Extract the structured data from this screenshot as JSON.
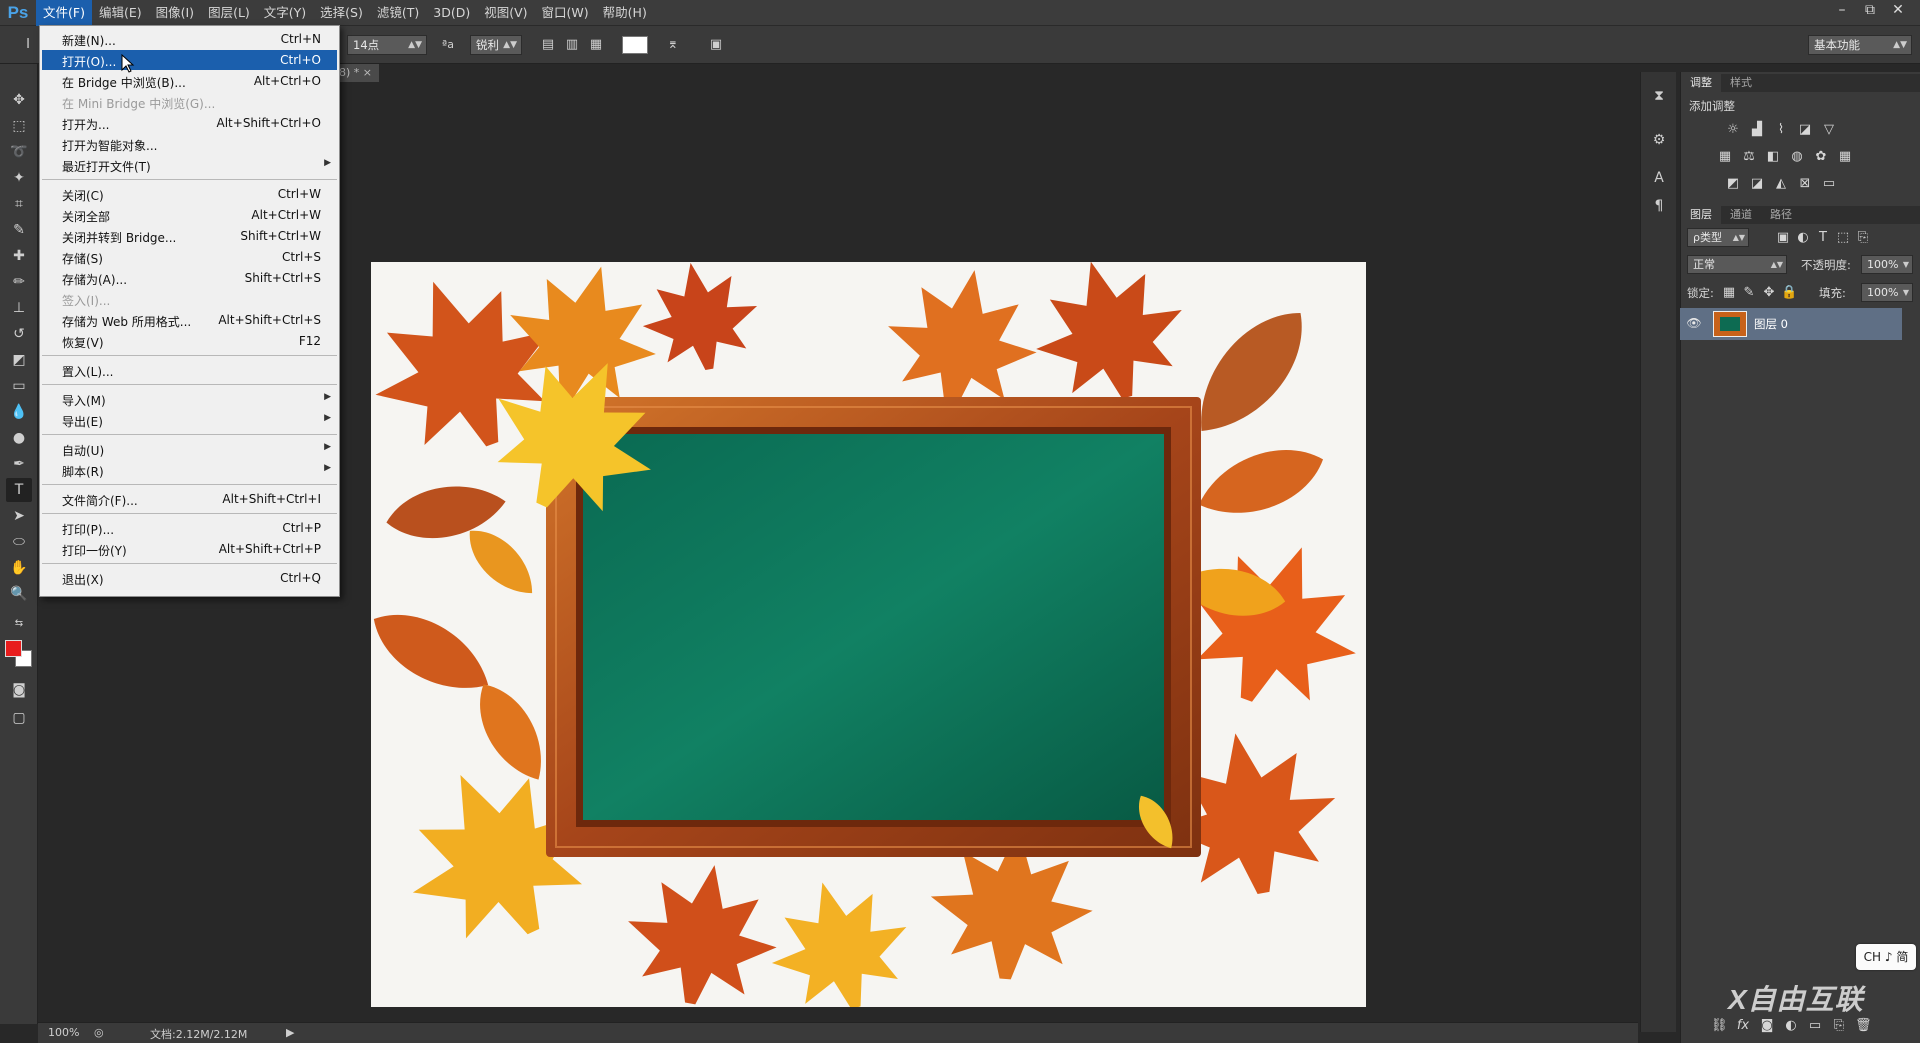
{
  "app": {
    "logo": "Ps",
    "menus": [
      "文件(F)",
      "编辑(E)",
      "图像(I)",
      "图层(L)",
      "文字(Y)",
      "选择(S)",
      "滤镜(T)",
      "3D(D)",
      "视图(V)",
      "窗口(W)",
      "帮助(H)"
    ],
    "active_menu": "文件(F)",
    "window_controls": [
      "–",
      "⧉",
      "✕"
    ]
  },
  "options_bar": {
    "font_size": "14点",
    "aa_icon": "ªa",
    "antialias": "锐利",
    "workspace": "基本功能"
  },
  "document": {
    "tab_label": "8) * ×",
    "zoom": "100%",
    "doc_info": "文档:2.12M/2.12M"
  },
  "file_menu": {
    "items": [
      {
        "label": "新建(N)...",
        "shortcut": "Ctrl+N"
      },
      {
        "label": "打开(O)...",
        "shortcut": "Ctrl+O",
        "highlighted": true
      },
      {
        "label": "在 Bridge 中浏览(B)...",
        "shortcut": "Alt+Ctrl+O"
      },
      {
        "label": "在 Mini Bridge 中浏览(G)...",
        "shortcut": "",
        "disabled": true
      },
      {
        "label": "打开为...",
        "shortcut": "Alt+Shift+Ctrl+O"
      },
      {
        "label": "打开为智能对象...",
        "shortcut": ""
      },
      {
        "label": "最近打开文件(T)",
        "shortcut": "",
        "submenu": true
      },
      {
        "separator": true
      },
      {
        "label": "关闭(C)",
        "shortcut": "Ctrl+W"
      },
      {
        "label": "关闭全部",
        "shortcut": "Alt+Ctrl+W"
      },
      {
        "label": "关闭并转到 Bridge...",
        "shortcut": "Shift+Ctrl+W"
      },
      {
        "label": "存储(S)",
        "shortcut": "Ctrl+S"
      },
      {
        "label": "存储为(A)...",
        "shortcut": "Shift+Ctrl+S"
      },
      {
        "label": "签入(I)...",
        "shortcut": "",
        "disabled": true
      },
      {
        "label": "存储为 Web 所用格式...",
        "shortcut": "Alt+Shift+Ctrl+S"
      },
      {
        "label": "恢复(V)",
        "shortcut": "F12"
      },
      {
        "separator": true
      },
      {
        "label": "置入(L)...",
        "shortcut": ""
      },
      {
        "separator": true
      },
      {
        "label": "导入(M)",
        "shortcut": "",
        "submenu": true
      },
      {
        "label": "导出(E)",
        "shortcut": "",
        "submenu": true
      },
      {
        "separator": true
      },
      {
        "label": "自动(U)",
        "shortcut": "",
        "submenu": true
      },
      {
        "label": "脚本(R)",
        "shortcut": "",
        "submenu": true
      },
      {
        "separator": true
      },
      {
        "label": "文件简介(F)...",
        "shortcut": "Alt+Shift+Ctrl+I"
      },
      {
        "separator": true
      },
      {
        "label": "打印(P)...",
        "shortcut": "Ctrl+P"
      },
      {
        "label": "打印一份(Y)",
        "shortcut": "Alt+Shift+Ctrl+P"
      },
      {
        "separator": true
      },
      {
        "label": "退出(X)",
        "shortcut": "Ctrl+Q"
      }
    ]
  },
  "adjustments_panel": {
    "tabs": [
      "调整",
      "样式"
    ],
    "active_tab": "调整",
    "title": "添加调整"
  },
  "layers_panel": {
    "tabs": [
      "图层",
      "通道",
      "路径"
    ],
    "active_tab": "图层",
    "filter": "ρ类型",
    "blend_mode": "正常",
    "opacity_label": "不透明度:",
    "opacity": "100%",
    "lock_label": "锁定:",
    "fill_label": "填充:",
    "fill": "100%",
    "layers": [
      {
        "name": "图层 0",
        "visible": true
      }
    ]
  },
  "ime": {
    "label": "CH ♪ 简"
  },
  "watermark": {
    "text": "X自由互联"
  },
  "colors": {
    "foreground": "#e81d1d",
    "background": "#ffffff",
    "highlight": "#1b5fad",
    "board": "#0d6b52",
    "frame": "#b4541a"
  }
}
